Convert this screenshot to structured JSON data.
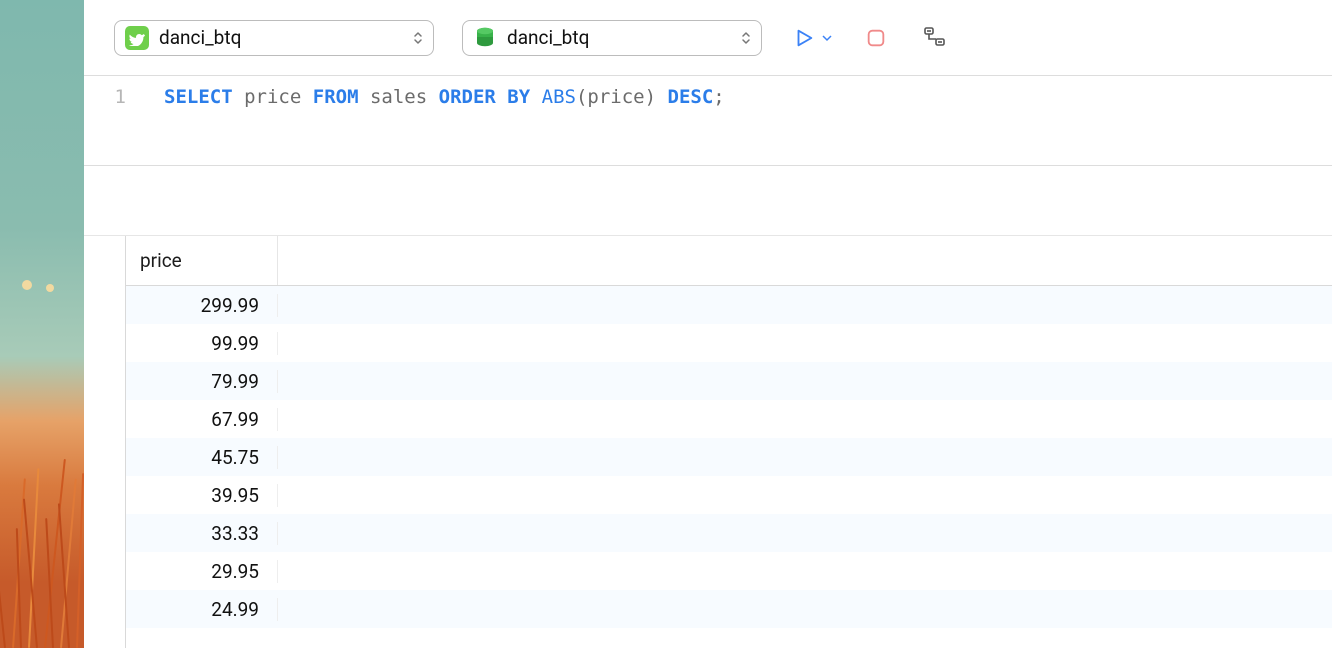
{
  "toolbar": {
    "connection_selector": {
      "label": "danci_btq"
    },
    "database_selector": {
      "label": "danci_btq"
    }
  },
  "editor": {
    "line_number": "1",
    "tokens": {
      "select": "SELECT",
      "col": "price",
      "from": "FROM",
      "table": "sales",
      "order": "ORDER",
      "by": "BY",
      "fn": "ABS",
      "lp": "(",
      "arg": "price",
      "rp": ")",
      "desc": "DESC",
      "semi": ";"
    }
  },
  "results": {
    "header": "price",
    "rows": [
      "299.99",
      "99.99",
      "79.99",
      "67.99",
      "45.75",
      "39.95",
      "33.33",
      "29.95",
      "24.99"
    ]
  }
}
